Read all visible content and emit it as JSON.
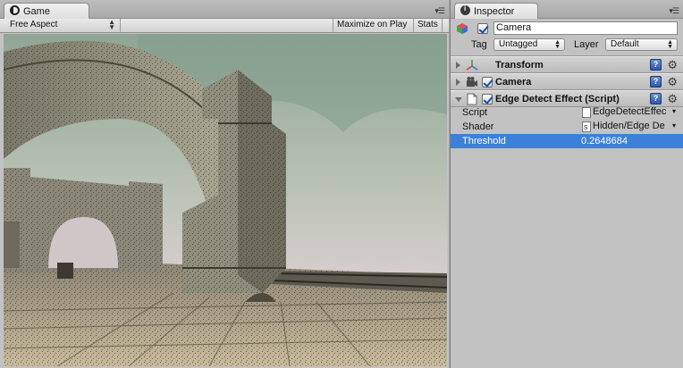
{
  "game": {
    "tab_label": "Game",
    "aspect_dropdown": "Free Aspect",
    "maximize_label": "Maximize on Play",
    "stats_label": "Stats",
    "panel_menu_icon": "panel-menu-icon"
  },
  "inspector": {
    "tab_label": "Inspector",
    "object": {
      "name": "Camera",
      "active": true,
      "tag_label": "Tag",
      "tag_value": "Untagged",
      "layer_label": "Layer",
      "layer_value": "Default"
    },
    "components": [
      {
        "title": "Transform",
        "expanded": false,
        "has_checkbox": false,
        "icon": "transform-icon"
      },
      {
        "title": "Camera",
        "expanded": false,
        "has_checkbox": true,
        "enabled": true,
        "icon": "camera-icon"
      },
      {
        "title": "Edge Detect Effect (Script)",
        "expanded": true,
        "has_checkbox": true,
        "enabled": true,
        "icon": "script-file-icon"
      }
    ],
    "properties": [
      {
        "label": "Script",
        "value": "EdgeDetectEffec",
        "kind": "object-field"
      },
      {
        "label": "Shader",
        "value": "Hidden/Edge De",
        "kind": "object-field"
      },
      {
        "label": "Threshold",
        "value": "0.2648684",
        "kind": "number",
        "selected": true
      }
    ],
    "help_glyph": "?",
    "gear_glyph": "⚙"
  },
  "colors": {
    "selection": "#3d80d9",
    "panel_bg": "#c2c2c2",
    "help_blue": "#2e56a4",
    "check_blue": "#1b4fa3"
  }
}
